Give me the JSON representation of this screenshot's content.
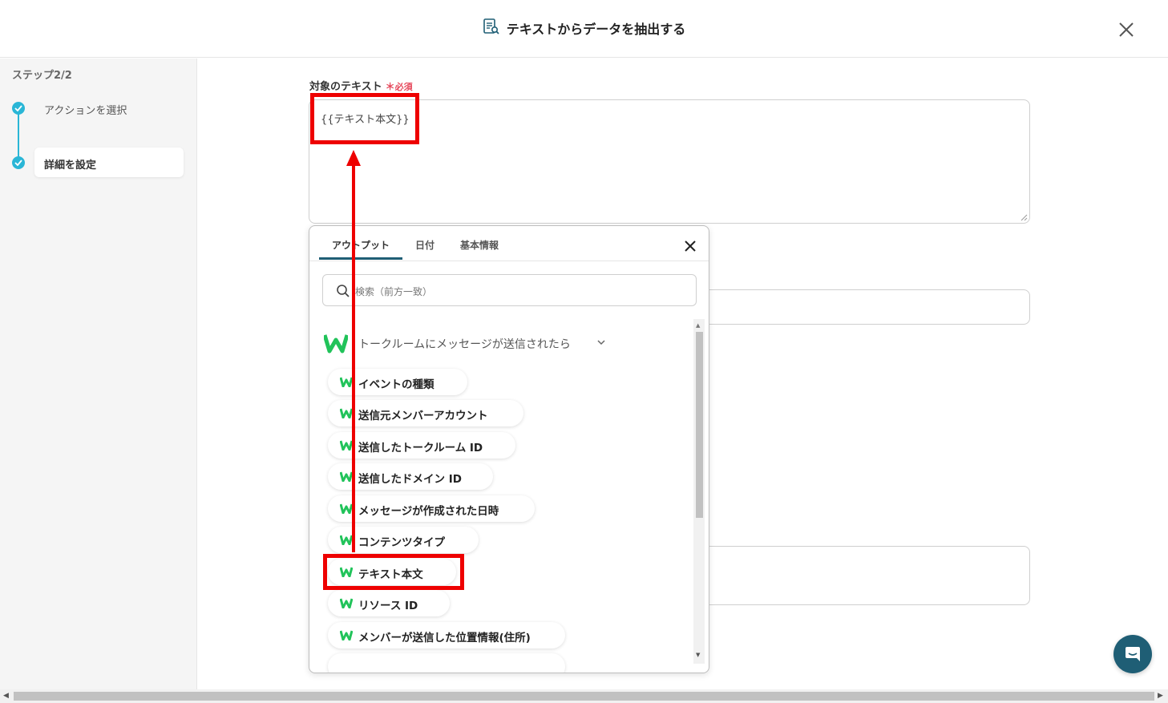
{
  "header": {
    "title": "テキストからデータを抽出する",
    "icon": "document-search-icon",
    "close_icon": "close-icon"
  },
  "sidebar": {
    "step_label": "ステップ2/2",
    "steps": [
      {
        "label": "アクションを選択",
        "state": "done"
      },
      {
        "label": "詳細を設定",
        "state": "active"
      }
    ]
  },
  "form": {
    "target_text_label": "対象のテキスト",
    "required_mark": "＊",
    "required_text": "必須",
    "target_text_value": "{{テキスト本文}}"
  },
  "popup": {
    "tabs": [
      {
        "label": "アウトプット",
        "active": true
      },
      {
        "label": "日付"
      },
      {
        "label": "基本情報"
      }
    ],
    "search_placeholder": "検索（前方一致）",
    "group_title": "トークルームにメッセージが送信されたら",
    "items": [
      {
        "label": "イベントの種類"
      },
      {
        "label": "送信元メンバーアカウント"
      },
      {
        "label": "送信したトークルーム ID"
      },
      {
        "label": "送信したドメイン ID"
      },
      {
        "label": "メッセージが作成された日時"
      },
      {
        "label": "コンテンツタイプ"
      },
      {
        "label": "テキスト本文",
        "highlighted": true
      },
      {
        "label": "リソース ID"
      },
      {
        "label": "メンバーが送信した位置情報(住所)"
      }
    ]
  },
  "colors": {
    "accent": "#1f5e75",
    "step": "#2ab6d6",
    "required": "#e6485b",
    "highlight": "#ee0000",
    "logo_green": "#21c35a"
  }
}
